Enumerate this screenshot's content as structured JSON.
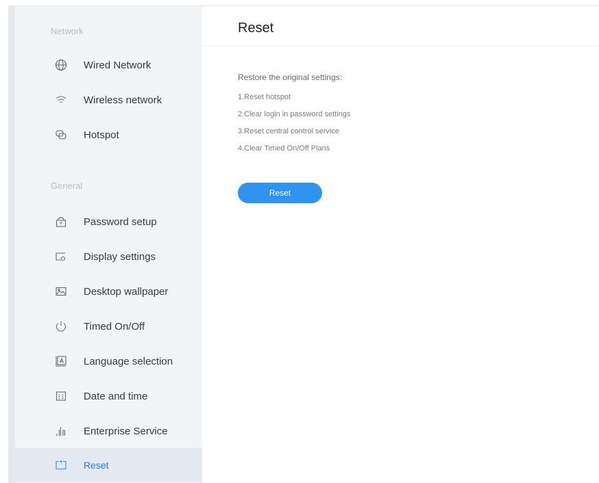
{
  "sidebar": {
    "sections": [
      {
        "title": "Network"
      },
      {
        "title": "General"
      }
    ],
    "network_items": [
      {
        "label": "Wired Network",
        "icon": "globe-icon"
      },
      {
        "label": "Wireless network",
        "icon": "wifi-icon"
      },
      {
        "label": "Hotspot",
        "icon": "hotspot-icon"
      }
    ],
    "general_items": [
      {
        "label": "Password setup",
        "icon": "lock-icon"
      },
      {
        "label": "Display settings",
        "icon": "display-icon"
      },
      {
        "label": "Desktop wallpaper",
        "icon": "image-icon"
      },
      {
        "label": "Timed On/Off",
        "icon": "power-icon"
      },
      {
        "label": "Language selection",
        "icon": "language-icon"
      },
      {
        "label": "Date and time",
        "icon": "calendar-icon"
      },
      {
        "label": "Enterprise Service",
        "icon": "bar-chart-icon"
      },
      {
        "label": "Reset",
        "icon": "reset-icon",
        "active": true
      }
    ]
  },
  "main": {
    "title": "Reset",
    "description": "Restore the original settings:",
    "items": [
      "1.Reset hotspot",
      "2.Clear login in password settings",
      "3.Reset central control service",
      "4.Clear Timed On/Off Plans"
    ],
    "reset_button_label": "Reset"
  },
  "colors": {
    "accent": "#2f93f0",
    "active_text": "#1f7fe0",
    "sidebar_bg": "#f3f4f6",
    "active_bg": "#e4e8f0"
  }
}
